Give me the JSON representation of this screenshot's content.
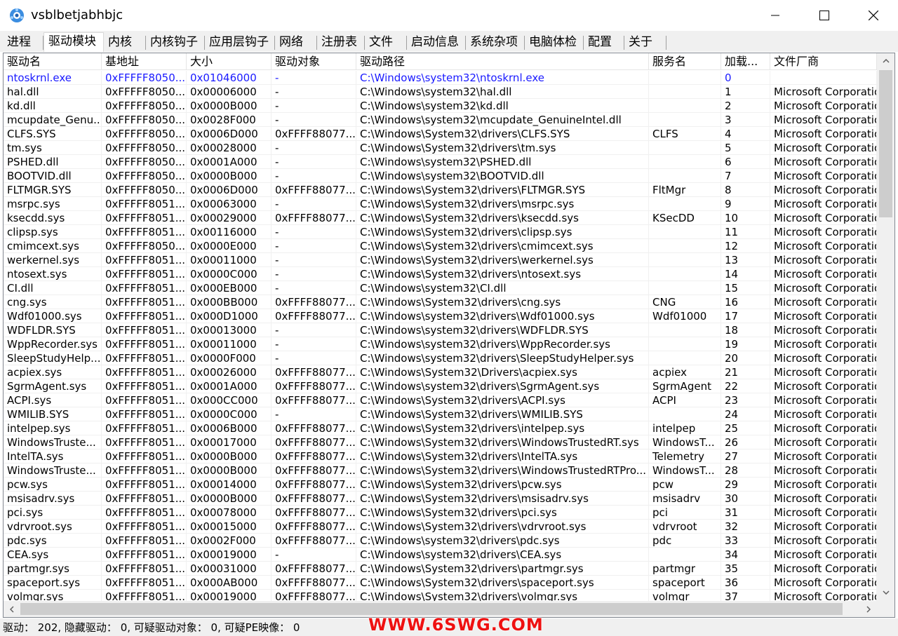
{
  "window": {
    "title": "vsblbetjabhbjc",
    "minimize": "minimize",
    "maximize": "maximize",
    "close": "close"
  },
  "tabs": [
    {
      "label": "进程"
    },
    {
      "label": "驱动模块",
      "active": true
    },
    {
      "label": "内核"
    },
    {
      "label": "内核钩子"
    },
    {
      "label": "应用层钩子"
    },
    {
      "label": "网络"
    },
    {
      "label": "注册表"
    },
    {
      "label": "文件"
    },
    {
      "label": "启动信息"
    },
    {
      "label": "系统杂项"
    },
    {
      "label": "电脑体检"
    },
    {
      "label": "配置"
    },
    {
      "label": "关于"
    }
  ],
  "table": {
    "columns": [
      "驱动名",
      "基地址",
      "大小",
      "驱动对象",
      "驱动路径",
      "服务名",
      "加载...",
      "文件厂商"
    ],
    "rows": [
      [
        "ntoskrnl.exe",
        "0xFFFFF8050...",
        "0x01046000",
        "-",
        "C:\\Windows\\system32\\ntoskrnl.exe",
        "",
        "0",
        ""
      ],
      [
        "hal.dll",
        "0xFFFFF8050...",
        "0x00006000",
        "-",
        "C:\\Windows\\system32\\hal.dll",
        "",
        "1",
        "Microsoft Corporatio"
      ],
      [
        "kd.dll",
        "0xFFFFF8050...",
        "0x0000B000",
        "-",
        "C:\\Windows\\system32\\kd.dll",
        "",
        "2",
        "Microsoft Corporatio"
      ],
      [
        "mcupdate_Genu...",
        "0xFFFFF8050...",
        "0x0028F000",
        "-",
        "C:\\Windows\\system32\\mcupdate_GenuineIntel.dll",
        "",
        "3",
        "Microsoft Corporatio"
      ],
      [
        "CLFS.SYS",
        "0xFFFFF8050...",
        "0x0006D000",
        "0xFFFF88077...",
        "C:\\Windows\\System32\\drivers\\CLFS.SYS",
        "CLFS",
        "4",
        "Microsoft Corporatio"
      ],
      [
        "tm.sys",
        "0xFFFFF8050...",
        "0x00028000",
        "-",
        "C:\\Windows\\System32\\drivers\\tm.sys",
        "",
        "5",
        "Microsoft Corporatio"
      ],
      [
        "PSHED.dll",
        "0xFFFFF8050...",
        "0x0001A000",
        "-",
        "C:\\Windows\\system32\\PSHED.dll",
        "",
        "6",
        "Microsoft Corporatio"
      ],
      [
        "BOOTVID.dll",
        "0xFFFFF8050...",
        "0x0000B000",
        "-",
        "C:\\Windows\\system32\\BOOTVID.dll",
        "",
        "7",
        "Microsoft Corporatio"
      ],
      [
        "FLTMGR.SYS",
        "0xFFFFF8050...",
        "0x0006D000",
        "0xFFFF88077...",
        "C:\\Windows\\System32\\drivers\\FLTMGR.SYS",
        "FltMgr",
        "8",
        "Microsoft Corporatio"
      ],
      [
        "msrpc.sys",
        "0xFFFFF8051...",
        "0x00063000",
        "-",
        "C:\\Windows\\System32\\drivers\\msrpc.sys",
        "",
        "9",
        "Microsoft Corporatio"
      ],
      [
        "ksecdd.sys",
        "0xFFFFF8051...",
        "0x00029000",
        "0xFFFF88077...",
        "C:\\Windows\\System32\\drivers\\ksecdd.sys",
        "KSecDD",
        "10",
        "Microsoft Corporatio"
      ],
      [
        "clipsp.sys",
        "0xFFFFF8051...",
        "0x00116000",
        "-",
        "C:\\Windows\\System32\\drivers\\clipsp.sys",
        "",
        "11",
        "Microsoft Corporatio"
      ],
      [
        "cmimcext.sys",
        "0xFFFFF8050...",
        "0x0000E000",
        "-",
        "C:\\Windows\\System32\\drivers\\cmimcext.sys",
        "",
        "12",
        "Microsoft Corporatio"
      ],
      [
        "werkernel.sys",
        "0xFFFFF8051...",
        "0x00011000",
        "-",
        "C:\\Windows\\System32\\drivers\\werkernel.sys",
        "",
        "13",
        "Microsoft Corporatio"
      ],
      [
        "ntosext.sys",
        "0xFFFFF8051...",
        "0x0000C000",
        "-",
        "C:\\Windows\\System32\\drivers\\ntosext.sys",
        "",
        "14",
        "Microsoft Corporatio"
      ],
      [
        "CI.dll",
        "0xFFFFF8051...",
        "0x000EB000",
        "-",
        "C:\\Windows\\system32\\CI.dll",
        "",
        "15",
        "Microsoft Corporatio"
      ],
      [
        "cng.sys",
        "0xFFFFF8051...",
        "0x000BB000",
        "0xFFFF88077...",
        "C:\\Windows\\System32\\drivers\\cng.sys",
        "CNG",
        "16",
        "Microsoft Corporatio"
      ],
      [
        "Wdf01000.sys",
        "0xFFFFF8051...",
        "0x000D1000",
        "0xFFFF88077...",
        "C:\\Windows\\system32\\drivers\\Wdf01000.sys",
        "Wdf01000",
        "17",
        "Microsoft Corporatio"
      ],
      [
        "WDFLDR.SYS",
        "0xFFFFF8051...",
        "0x00013000",
        "-",
        "C:\\Windows\\system32\\drivers\\WDFLDR.SYS",
        "",
        "18",
        "Microsoft Corporatio"
      ],
      [
        "WppRecorder.sys",
        "0xFFFFF8051...",
        "0x00011000",
        "-",
        "C:\\Windows\\system32\\drivers\\WppRecorder.sys",
        "",
        "19",
        "Microsoft Corporatio"
      ],
      [
        "SleepStudyHelp...",
        "0xFFFFF8051...",
        "0x0000F000",
        "-",
        "C:\\Windows\\system32\\drivers\\SleepStudyHelper.sys",
        "",
        "20",
        "Microsoft Corporatio"
      ],
      [
        "acpiex.sys",
        "0xFFFFF8051...",
        "0x00026000",
        "0xFFFF88077...",
        "C:\\Windows\\System32\\Drivers\\acpiex.sys",
        "acpiex",
        "21",
        "Microsoft Corporatio"
      ],
      [
        "SgrmAgent.sys",
        "0xFFFFF8051...",
        "0x0001A000",
        "0xFFFF88077...",
        "C:\\Windows\\system32\\drivers\\SgrmAgent.sys",
        "SgrmAgent",
        "22",
        "Microsoft Corporatio"
      ],
      [
        "ACPI.sys",
        "0xFFFFF8051...",
        "0x000CC000",
        "0xFFFF88077...",
        "C:\\Windows\\System32\\drivers\\ACPI.sys",
        "ACPI",
        "23",
        "Microsoft Corporatio"
      ],
      [
        "WMILIB.SYS",
        "0xFFFFF8051...",
        "0x0000C000",
        "-",
        "C:\\Windows\\System32\\drivers\\WMILIB.SYS",
        "",
        "24",
        "Microsoft Corporatio"
      ],
      [
        "intelpep.sys",
        "0xFFFFF8051...",
        "0x0006B000",
        "0xFFFF88077...",
        "C:\\Windows\\System32\\drivers\\intelpep.sys",
        "intelpep",
        "25",
        "Microsoft Corporatio"
      ],
      [
        "WindowsTruste...",
        "0xFFFFF8051...",
        "0x00017000",
        "0xFFFF88077...",
        "C:\\Windows\\System32\\drivers\\WindowsTrustedRT.sys",
        "WindowsT...",
        "26",
        "Microsoft Corporatio"
      ],
      [
        "IntelTA.sys",
        "0xFFFFF8051...",
        "0x0000B000",
        "0xFFFF88077...",
        "C:\\Windows\\System32\\drivers\\IntelTA.sys",
        "Telemetry",
        "27",
        "Microsoft Corporatio"
      ],
      [
        "WindowsTruste...",
        "0xFFFFF8051...",
        "0x0000B000",
        "0xFFFF88077...",
        "C:\\Windows\\System32\\drivers\\WindowsTrustedRTPro...",
        "WindowsT...",
        "28",
        "Microsoft Corporatio"
      ],
      [
        "pcw.sys",
        "0xFFFFF8051...",
        "0x00014000",
        "0xFFFF88077...",
        "C:\\Windows\\System32\\drivers\\pcw.sys",
        "pcw",
        "29",
        "Microsoft Corporatio"
      ],
      [
        "msisadrv.sys",
        "0xFFFFF8051...",
        "0x0000B000",
        "0xFFFF88077...",
        "C:\\Windows\\System32\\drivers\\msisadrv.sys",
        "msisadrv",
        "30",
        "Microsoft Corporatio"
      ],
      [
        "pci.sys",
        "0xFFFFF8051...",
        "0x00078000",
        "0xFFFF88077...",
        "C:\\Windows\\System32\\drivers\\pci.sys",
        "pci",
        "31",
        "Microsoft Corporatio"
      ],
      [
        "vdrvroot.sys",
        "0xFFFFF8051...",
        "0x00015000",
        "0xFFFF88077...",
        "C:\\Windows\\System32\\drivers\\vdrvroot.sys",
        "vdrvroot",
        "32",
        "Microsoft Corporatio"
      ],
      [
        "pdc.sys",
        "0xFFFFF8051...",
        "0x0002F000",
        "0xFFFF88077...",
        "C:\\Windows\\system32\\drivers\\pdc.sys",
        "pdc",
        "33",
        "Microsoft Corporatio"
      ],
      [
        "CEA.sys",
        "0xFFFFF8051...",
        "0x00019000",
        "-",
        "C:\\Windows\\system32\\drivers\\CEA.sys",
        "",
        "34",
        "Microsoft Corporatio"
      ],
      [
        "partmgr.sys",
        "0xFFFFF8051...",
        "0x00031000",
        "0xFFFF88077...",
        "C:\\Windows\\System32\\drivers\\partmgr.sys",
        "partmgr",
        "35",
        "Microsoft Corporatio"
      ],
      [
        "spaceport.sys",
        "0xFFFFF8051...",
        "0x000AB000",
        "0xFFFF88077...",
        "C:\\Windows\\System32\\drivers\\spaceport.sys",
        "spaceport",
        "36",
        "Microsoft Corporatio"
      ],
      [
        "volmgr.sys",
        "0xFFFFF8051...",
        "0x00019000",
        "0xFFFF88077...",
        "C:\\Windows\\System32\\drivers\\volmgr.sys",
        "volmgr",
        "37",
        "Microsoft Corporatio"
      ]
    ]
  },
  "status": {
    "text": "驱动： 202, 隐藏驱动： 0, 可疑驱动对象： 0, 可疑PE映像： 0"
  },
  "watermark": "WWW.6SWG.COM",
  "colors": {
    "highlight_row": "#1a1aff",
    "watermark": "#ee1111",
    "tabbar_bg": "#f0f0f0"
  }
}
